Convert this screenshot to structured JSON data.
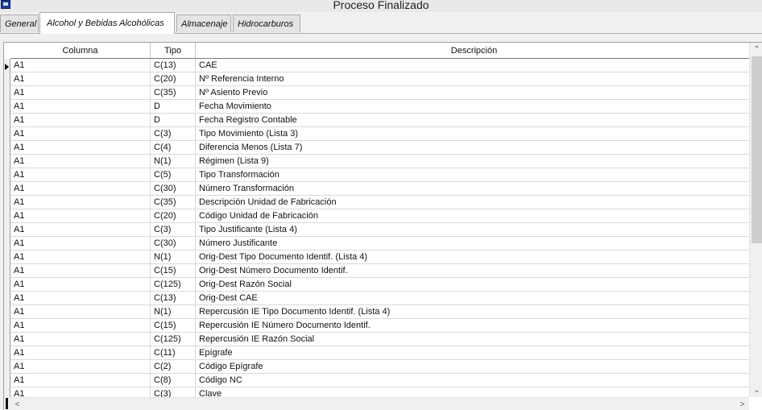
{
  "window": {
    "title": "Proceso Finalizado",
    "icon": "app-icon"
  },
  "tabs": [
    {
      "label": "General",
      "active": false
    },
    {
      "label": "Alcohol y Bebidas Alcohólicas",
      "active": true
    },
    {
      "label": "Almacenaje",
      "active": false
    },
    {
      "label": "Hidrocarburos",
      "active": false
    }
  ],
  "grid": {
    "columns": [
      "Columna",
      "Tipo",
      "Descripción"
    ],
    "rows": [
      {
        "columna": "A1",
        "tipo": "C(13)",
        "descripcion": "CAE"
      },
      {
        "columna": "A1",
        "tipo": "C(20)",
        "descripcion": "Nº Referencia Interno"
      },
      {
        "columna": "A1",
        "tipo": "C(35)",
        "descripcion": "Nº Asiento Previo"
      },
      {
        "columna": "A1",
        "tipo": "D",
        "descripcion": "Fecha Movimiento"
      },
      {
        "columna": "A1",
        "tipo": "D",
        "descripcion": "Fecha Registro Contable"
      },
      {
        "columna": "A1",
        "tipo": "C(3)",
        "descripcion": "Tipo Movimiento (Lista 3)"
      },
      {
        "columna": "A1",
        "tipo": "C(4)",
        "descripcion": "Diferencia Menos (Lista 7)"
      },
      {
        "columna": "A1",
        "tipo": "N(1)",
        "descripcion": "Régimen (Lista 9)"
      },
      {
        "columna": "A1",
        "tipo": "C(5)",
        "descripcion": "Tipo Transformación"
      },
      {
        "columna": "A1",
        "tipo": "C(30)",
        "descripcion": "Número Transformación"
      },
      {
        "columna": "A1",
        "tipo": "C(35)",
        "descripcion": "Descripción Unidad de Fabricación"
      },
      {
        "columna": "A1",
        "tipo": "C(20)",
        "descripcion": "Código Unidad de Fabricación"
      },
      {
        "columna": "A1",
        "tipo": "C(3)",
        "descripcion": "Tipo Justificante (Lista 4)"
      },
      {
        "columna": "A1",
        "tipo": "C(30)",
        "descripcion": "Número Justificante"
      },
      {
        "columna": "A1",
        "tipo": "N(1)",
        "descripcion": "Orig-Dest Tipo Documento Identif. (Lista 4)"
      },
      {
        "columna": "A1",
        "tipo": "C(15)",
        "descripcion": "Orig-Dest Número Documento Identif."
      },
      {
        "columna": "A1",
        "tipo": "C(125)",
        "descripcion": "Orig-Dest Razón Social"
      },
      {
        "columna": "A1",
        "tipo": "C(13)",
        "descripcion": "Orig-Dest CAE"
      },
      {
        "columna": "A1",
        "tipo": "N(1)",
        "descripcion": "Repercusión IE Tipo Documento Identif. (Lista 4)"
      },
      {
        "columna": "A1",
        "tipo": "C(15)",
        "descripcion": "Repercusión IE Número Documento Identif."
      },
      {
        "columna": "A1",
        "tipo": "C(125)",
        "descripcion": "Repercusión IE Razón Social"
      },
      {
        "columna": "A1",
        "tipo": "C(11)",
        "descripcion": "Epígrafe"
      },
      {
        "columna": "A1",
        "tipo": "C(2)",
        "descripcion": "Código Epígrafe"
      },
      {
        "columna": "A1",
        "tipo": "C(8)",
        "descripcion": "Código NC"
      },
      {
        "columna": "A1",
        "tipo": "C(3)",
        "descripcion": "Clave"
      }
    ]
  },
  "scroll": {
    "up_glyph": "⌃",
    "down_glyph": "⌄",
    "left_glyph": "<",
    "right_glyph": ">"
  }
}
